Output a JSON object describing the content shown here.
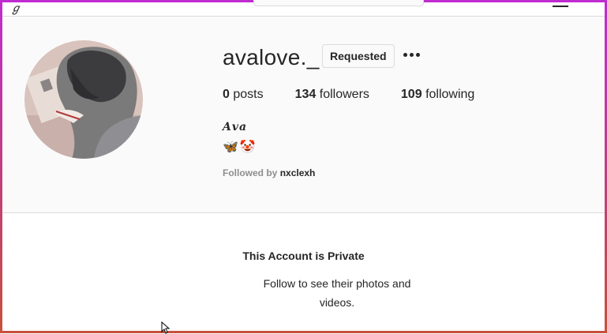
{
  "profile": {
    "username": "avalove._",
    "requested_label": "Requested",
    "posts_count": "0",
    "posts_label": "posts",
    "followers_count": "134",
    "followers_label": "followers",
    "following_count": "109",
    "following_label": "following",
    "full_name": "𝑨𝒗𝒂",
    "bio_emojis": [
      "🦋",
      "🤡"
    ],
    "followed_by_prefix": "Followed by",
    "followed_by_user": "nxclexh"
  },
  "private_notice": {
    "title": "This Account is Private",
    "message": "Follow to see their photos and videos."
  },
  "colors": {
    "frame_gradient_top": "#c02ccf",
    "frame_gradient_bottom": "#c8503c",
    "text_primary": "#262626",
    "text_secondary": "#8e8e8e",
    "divider": "#dbdbdb"
  }
}
